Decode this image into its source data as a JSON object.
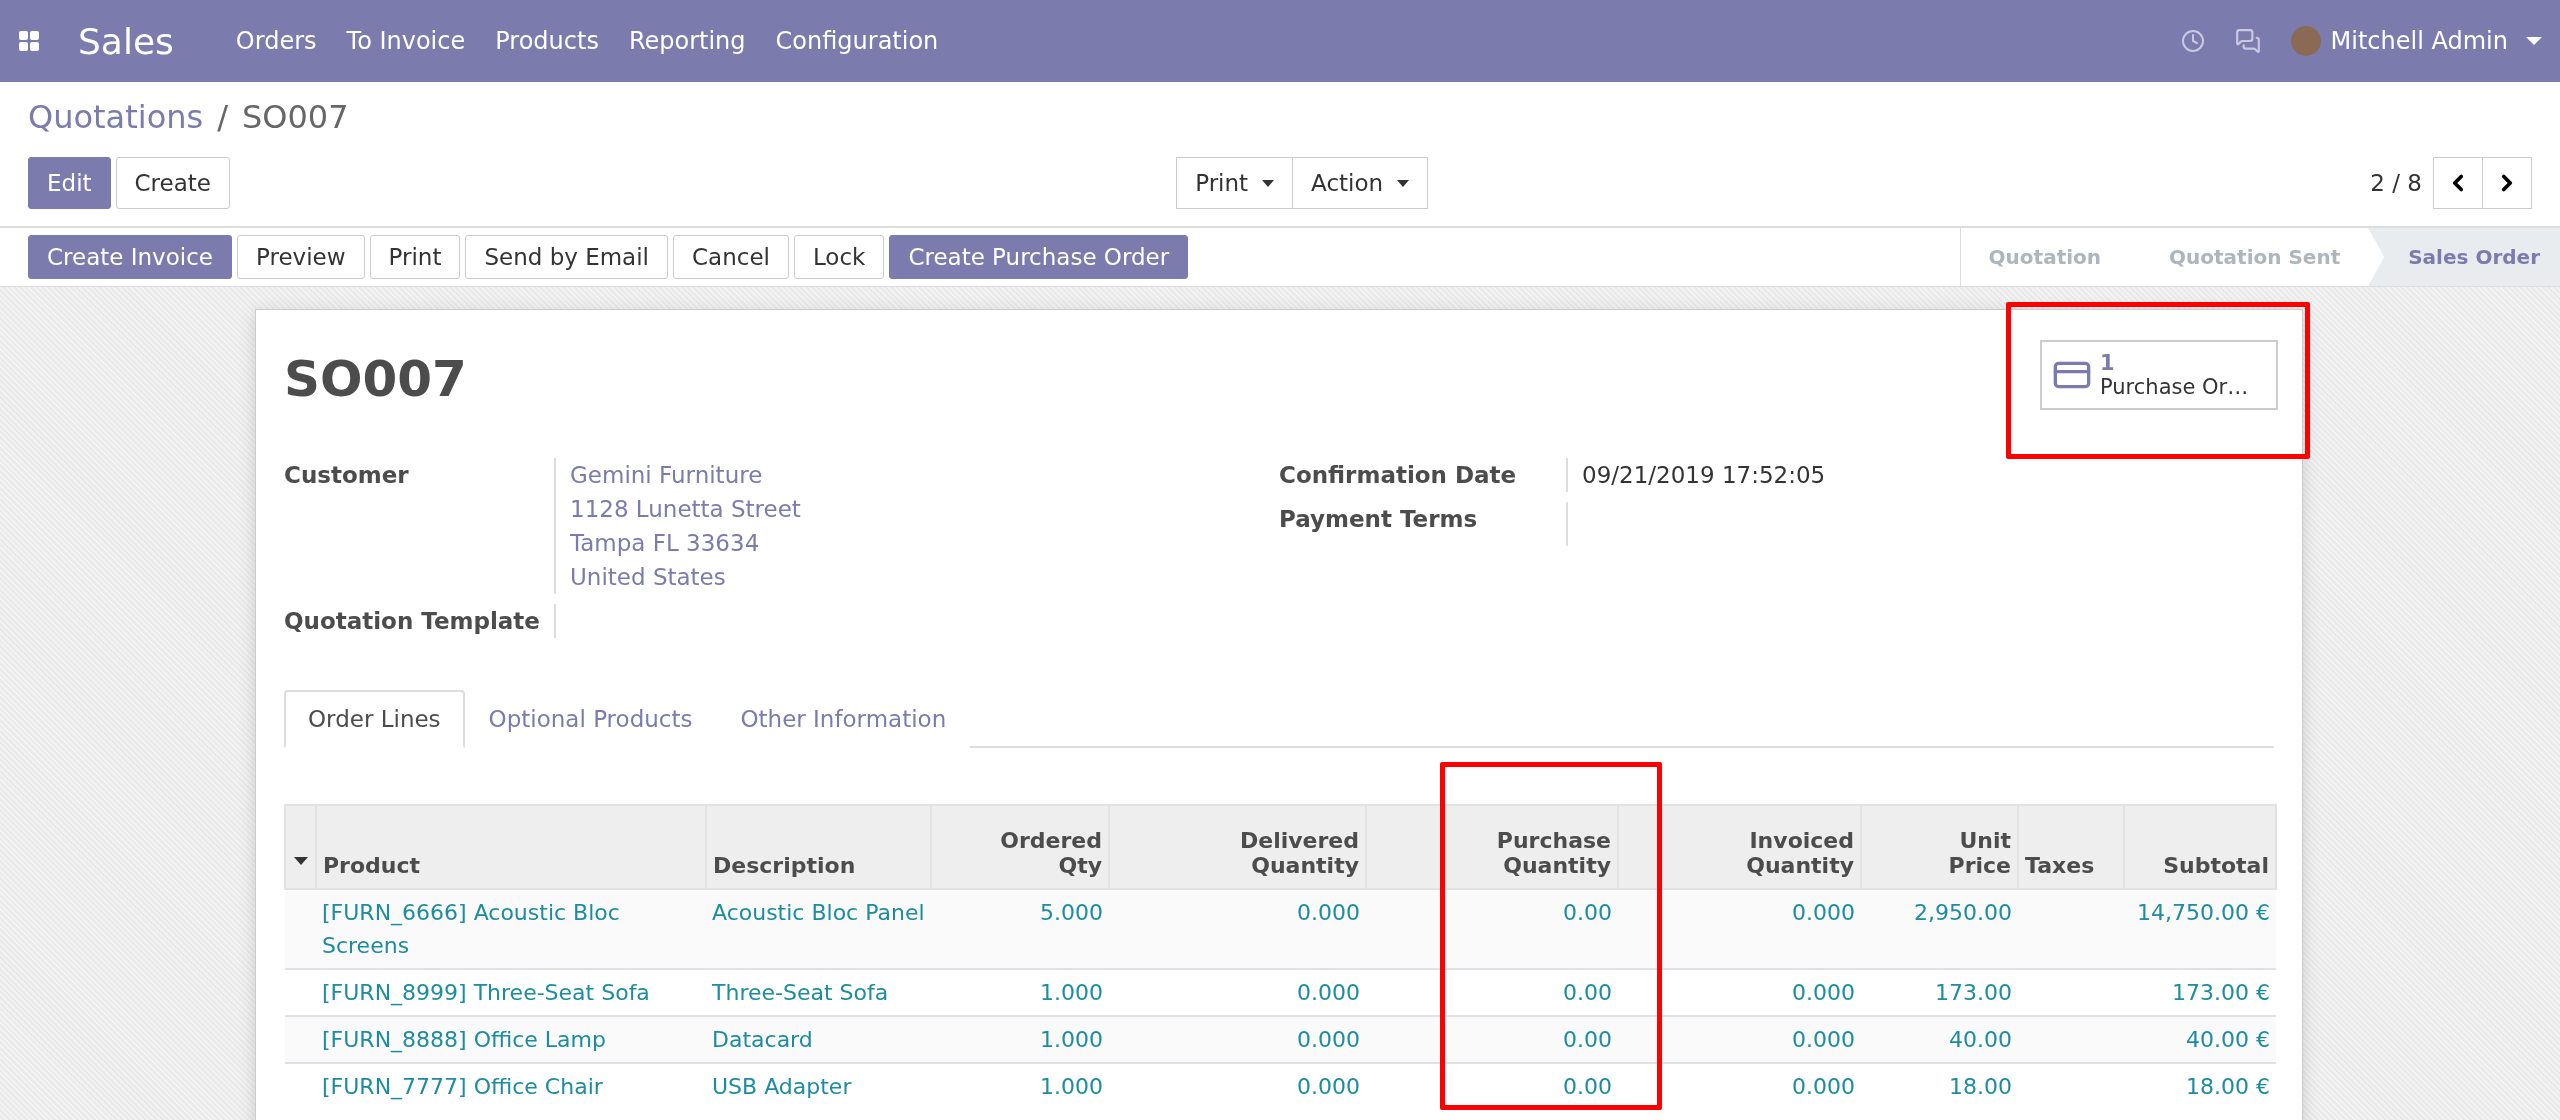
{
  "navbar": {
    "app": "Sales",
    "menu": [
      "Orders",
      "To Invoice",
      "Products",
      "Reporting",
      "Configuration"
    ],
    "user": "Mitchell Admin"
  },
  "breadcrumb": {
    "parent": "Quotations",
    "separator": "/",
    "current": "SO007"
  },
  "control_buttons": [
    {
      "label": "Edit",
      "primary": true
    },
    {
      "label": "Create",
      "primary": false
    }
  ],
  "dropdowns": [
    "Print",
    "Action"
  ],
  "pager": "2 / 8",
  "action_buttons": [
    {
      "label": "Create Invoice",
      "primary": true
    },
    {
      "label": "Preview",
      "primary": false
    },
    {
      "label": "Print",
      "primary": false
    },
    {
      "label": "Send by Email",
      "primary": false
    },
    {
      "label": "Cancel",
      "primary": false
    },
    {
      "label": "Lock",
      "primary": false
    },
    {
      "label": "Create Purchase Order",
      "primary": true
    }
  ],
  "stages": [
    {
      "label": "Quotation",
      "selected": false
    },
    {
      "label": "Quotation Sent",
      "selected": false
    },
    {
      "label": "Sales Order",
      "selected": true
    }
  ],
  "smart_button": {
    "count": "1",
    "label": "Purchase Or…",
    "highlighted": true
  },
  "title": "SO007",
  "fields_left": [
    {
      "label": "Customer",
      "lines": [
        "Gemini Furniture",
        "1128 Lunetta Street",
        "Tampa FL 33634",
        "United States"
      ]
    },
    {
      "label": "Quotation Template"
    }
  ],
  "fields_right": [
    {
      "label": "Confirmation Date",
      "value": "09/21/2019 17:52:05"
    },
    {
      "label": "Payment Terms"
    }
  ],
  "tabs": [
    {
      "label": "Order Lines",
      "selected": true
    },
    {
      "label": "Optional Products",
      "selected": false
    },
    {
      "label": "Other Information",
      "selected": false
    }
  ],
  "table": {
    "columns": [
      {
        "label": "Product",
        "highlighted": false
      },
      {
        "label": "Description",
        "highlighted": false
      },
      {
        "label": "Ordered Qty",
        "highlighted": false
      },
      {
        "label": "Delivered Quantity",
        "highlighted": false
      },
      {
        "label": "Purchase Quantity",
        "highlighted": true
      },
      {
        "label": "Invoiced Quantity",
        "highlighted": false
      },
      {
        "label": "Unit Price",
        "highlighted": false
      },
      {
        "label": "Taxes",
        "highlighted": false
      },
      {
        "label": "Subtotal",
        "highlighted": false
      }
    ],
    "rows": [
      [
        "[FURN_6666] Acoustic Bloc Screens",
        "Acoustic Bloc Panel",
        "5.000",
        "0.000",
        "0.00",
        "0.000",
        "2,950.00",
        "",
        "14,750.00 €"
      ],
      [
        "[FURN_8999] Three-Seat Sofa",
        "Three-Seat Sofa",
        "1.000",
        "0.000",
        "0.00",
        "0.000",
        "173.00",
        "",
        "173.00 €"
      ],
      [
        "[FURN_8888] Office Lamp",
        "Datacard",
        "1.000",
        "0.000",
        "0.00",
        "0.000",
        "40.00",
        "",
        "40.00 €"
      ],
      [
        "[FURN_7777] Office Chair",
        "USB Adapter",
        "1.000",
        "0.000",
        "0.00",
        "0.000",
        "18.00",
        "",
        "18.00 €"
      ]
    ]
  }
}
